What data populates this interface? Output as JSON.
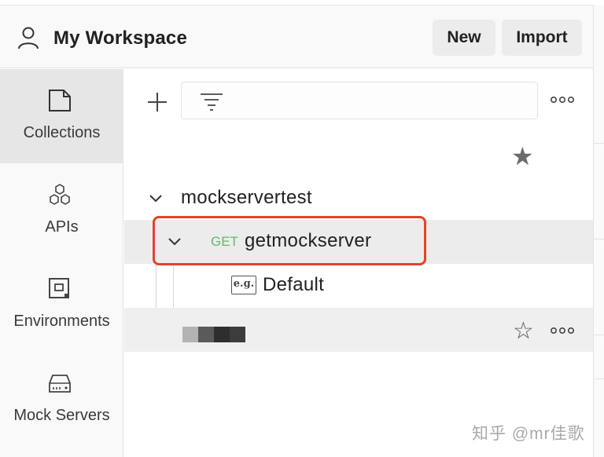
{
  "header": {
    "workspace_title": "My Workspace",
    "new_label": "New",
    "import_label": "Import"
  },
  "nav": {
    "items": [
      {
        "label": "Collections",
        "icon": "collections-icon",
        "active": true
      },
      {
        "label": "APIs",
        "icon": "apis-icon",
        "active": false
      },
      {
        "label": "Environments",
        "icon": "environments-icon",
        "active": false
      },
      {
        "label": "Mock Servers",
        "icon": "mock-servers-icon",
        "active": false
      }
    ]
  },
  "collections": {
    "search_value": "",
    "collection_name": "mockservertest",
    "request": {
      "method": "GET",
      "name": "getmockserver"
    },
    "example": {
      "badge": "e.g.",
      "name": "Default"
    }
  },
  "colors": {
    "get_method": "#5fb96b",
    "highlight_border": "#e0452b",
    "active_nav_bg": "#e6e6e6"
  },
  "watermark": "知乎 @mr佳歌"
}
